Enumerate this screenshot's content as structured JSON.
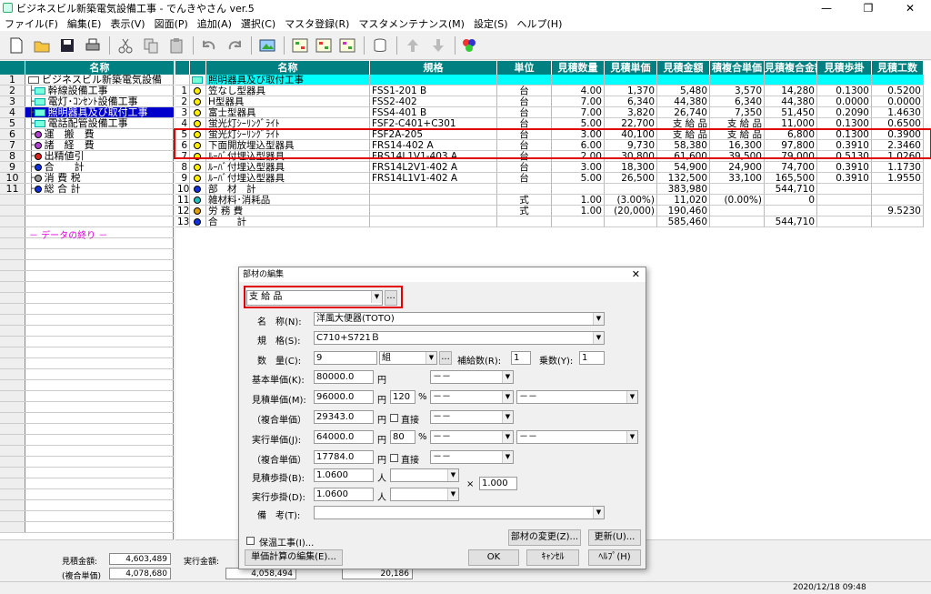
{
  "window": {
    "title": "ビジネスビル新築電気設備工事 - でんきやさん ver.5",
    "minimize": "—",
    "maximize": "❐",
    "close": "✕"
  },
  "menu": [
    "ファイル(F)",
    "編集(E)",
    "表示(V)",
    "図面(P)",
    "追加(A)",
    "選択(C)",
    "マスタ登録(R)",
    "マスタメンテナンス(M)",
    "設定(S)",
    "ヘルプ(H)"
  ],
  "tree": {
    "header": "名称",
    "rows": [
      {
        "num": "1",
        "label": "ビジネスビル新築電気設備",
        "icon": "page"
      },
      {
        "num": "2",
        "label": "幹線設備工事",
        "icon": "box"
      },
      {
        "num": "3",
        "label": "電灯･ｺﾝｾﾝﾄ設備工事",
        "icon": "box"
      },
      {
        "num": "4",
        "label": "照明器具及び取付工事",
        "icon": "box"
      },
      {
        "num": "5",
        "label": "電話配管設備工事",
        "icon": "box"
      },
      {
        "num": "6",
        "label": "運　搬　費",
        "icon": "purple"
      },
      {
        "num": "7",
        "label": "諸　経　費",
        "icon": "purple"
      },
      {
        "num": "8",
        "label": "出精値引",
        "icon": "red"
      },
      {
        "num": "9",
        "label": "合　　計",
        "icon": "blue"
      },
      {
        "num": "10",
        "label": "消 費 税",
        "icon": "gray"
      },
      {
        "num": "11",
        "label": "総 合 計",
        "icon": "navy"
      }
    ],
    "end_marker": "－ データの終り －"
  },
  "grid": {
    "headers": [
      "名称",
      "規格",
      "単位",
      "見積数量",
      "見積単価",
      "見積金額",
      "積複合単価",
      "見積複合金額",
      "見積歩掛",
      "見積工数"
    ],
    "section_title": "照明器具及び取付工事",
    "rows": [
      {
        "num": "1",
        "name": "笠なし型器具",
        "spec": "FSS1-201 B",
        "unit": "台",
        "qty": "4.00",
        "price": "1,370",
        "amount": "5,480",
        "cprice": "3,570",
        "camount": "14,280",
        "rate": "0.1300",
        "work": "0.5200"
      },
      {
        "num": "2",
        "name": "H型器具",
        "spec": "FSS2-402",
        "unit": "台",
        "qty": "7.00",
        "price": "6,340",
        "amount": "44,380",
        "cprice": "6,340",
        "camount": "44,380",
        "rate": "0.0000",
        "work": "0.0000"
      },
      {
        "num": "3",
        "name": "富士型器具",
        "spec": "FSS4-401 B",
        "unit": "台",
        "qty": "7.00",
        "price": "3,820",
        "amount": "26,740",
        "cprice": "7,350",
        "camount": "51,450",
        "rate": "0.2090",
        "work": "1.4630"
      },
      {
        "num": "4",
        "name": "蛍光灯ｼｰﾘﾝｸﾞﾗｲﾄ",
        "spec": "FSF2-C401+C301",
        "unit": "台",
        "qty": "5.00",
        "price": "22,700",
        "amount": "支 給 品",
        "cprice": "支 給 品",
        "camount": "11,000",
        "rate": "0.1300",
        "work": "0.6500"
      },
      {
        "num": "5",
        "name": "蛍光灯ｼｰﾘﾝｸﾞﾗｲﾄ",
        "spec": "FSF2A-205",
        "unit": "台",
        "qty": "3.00",
        "price": "40,100",
        "amount": "支 給 品",
        "cprice": "支 給 品",
        "camount": "6,800",
        "rate": "0.1300",
        "work": "0.3900"
      },
      {
        "num": "6",
        "name": "下面開放埋込型器具",
        "spec": "FRS14-402 A",
        "unit": "台",
        "qty": "6.00",
        "price": "9,730",
        "amount": "58,380",
        "cprice": "16,300",
        "camount": "97,800",
        "rate": "0.3910",
        "work": "2.3460"
      },
      {
        "num": "7",
        "name": "ﾙｰﾊﾞ付埋込型器具",
        "spec": "FRS14L1V1-403 A",
        "unit": "台",
        "qty": "2.00",
        "price": "30,800",
        "amount": "61,600",
        "cprice": "39,500",
        "camount": "79,000",
        "rate": "0.5130",
        "work": "1.0260"
      },
      {
        "num": "8",
        "name": "ﾙｰﾊﾞ付埋込型器具",
        "spec": "FRS14L2V1-402 A",
        "unit": "台",
        "qty": "3.00",
        "price": "18,300",
        "amount": "54,900",
        "cprice": "24,900",
        "camount": "74,700",
        "rate": "0.3910",
        "work": "1.1730"
      },
      {
        "num": "9",
        "name": "ﾙｰﾊﾞ付埋込型器具",
        "spec": "FRS14L1V1-402 A",
        "unit": "台",
        "qty": "5.00",
        "price": "26,500",
        "amount": "132,500",
        "cprice": "33,100",
        "camount": "165,500",
        "rate": "0.3910",
        "work": "1.9550"
      },
      {
        "num": "10",
        "name": "部　材　計",
        "spec": "",
        "unit": "",
        "qty": "",
        "price": "",
        "amount": "383,980",
        "cprice": "",
        "camount": "544,710",
        "rate": "",
        "work": ""
      },
      {
        "num": "11",
        "name": "雑材料･消耗品",
        "spec": "",
        "unit": "式",
        "qty": "1.00",
        "price": "(3.00%)",
        "amount": "11,020",
        "cprice": "(0.00%)",
        "camount": "0",
        "rate": "",
        "work": ""
      },
      {
        "num": "12",
        "name": "労 務 費",
        "spec": "",
        "unit": "式",
        "qty": "1.00",
        "price": "(20,000)",
        "amount": "190,460",
        "cprice": "",
        "camount": "",
        "rate": "",
        "work": "9.5230"
      },
      {
        "num": "13",
        "name": "合　　計",
        "spec": "",
        "unit": "",
        "qty": "",
        "price": "",
        "amount": "585,460",
        "cprice": "",
        "camount": "544,710",
        "rate": "",
        "work": ""
      }
    ]
  },
  "footer": {
    "est_amount_label": "見積金額:",
    "est_amount": "4,603,489",
    "est_composite_label": "(複合単価)",
    "est_composite": "4,078,680",
    "exec_amount_label": "実行金額:",
    "exec_value": "4,058,494",
    "exec_value2": "20,186",
    "datetime": "2020/12/18 09:48"
  },
  "dialog": {
    "title": "部材の編集",
    "close": "✕",
    "type_select": "支 給 品",
    "type_btn": "...",
    "name_label": "名　称(N):",
    "name_value": "洋風大便器(TOTO)",
    "spec_label": "規　格(S):",
    "spec_value": "C710+S721Ｂ",
    "qty_label": "数　量(C):",
    "qty_value": "9",
    "unit_value": "組",
    "supp_label": "補給数(R):",
    "supp_value": "1",
    "mult_label": "乗数(Y):",
    "mult_value": "1",
    "base_label": "基本単価(K):",
    "base_value": "80000.0",
    "yen": "円",
    "base_sel": "－－",
    "est_label": "見積単価(M):",
    "est_value": "96000.0",
    "est_pct": "120",
    "pct": "%",
    "est_sel": "－－",
    "est_sel2": "－－",
    "comp1_label": "（複合単価）",
    "comp1_value": "29343.0",
    "direct_label": "直接",
    "comp1_sel": "－－",
    "exec_label": "実行単価(J):",
    "exec_value": "64000.0",
    "exec_pct": "80",
    "exec_sel": "－－",
    "exec_sel2": "－－",
    "comp2_label": "（複合単価）",
    "comp2_value": "17784.0",
    "comp2_sel": "－－",
    "est_rate_label": "見積歩掛(B):",
    "est_rate_value": "1.0600",
    "person": "人",
    "times": "×",
    "times_value": "1.000",
    "exec_rate_label": "実行歩掛(D):",
    "exec_rate_value": "1.0600",
    "note_label": "備　考(T):",
    "note_value": "",
    "insulation_label": "保温工事(I)...",
    "change_btn": "部材の変更(Z)...",
    "update_btn": "更新(U)...",
    "calc_btn": "単価計算の編集(E)...",
    "ok_btn": "OK",
    "cancel_btn": "ｷｬﾝｾﾙ",
    "help_btn": "ﾍﾙﾌﾟ(H)"
  }
}
